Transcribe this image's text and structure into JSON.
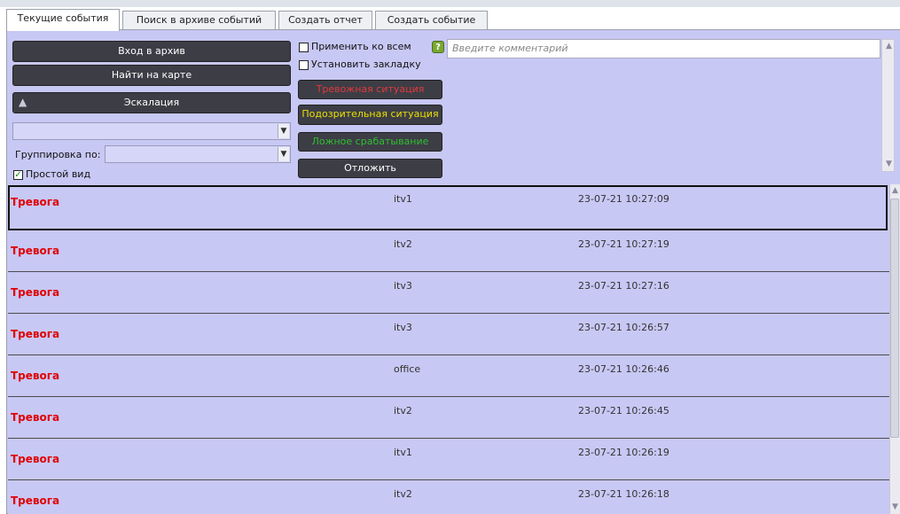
{
  "tabs": [
    {
      "label": "Текущие события",
      "active": true
    },
    {
      "label": "Поиск в архиве событий",
      "active": false
    },
    {
      "label": "Создать отчет",
      "active": false
    },
    {
      "label": "Создать событие",
      "active": false
    }
  ],
  "controls": {
    "archive_button": "Вход в архив",
    "map_button": "Найти на карте",
    "escalation_button": "Эскалация",
    "escalation_combo_value": "",
    "grouping_label": "Группировка по:",
    "grouping_value": "",
    "simple_view_label": "Простой вид",
    "simple_view_checked": true,
    "apply_all_label": "Применить ко всем",
    "apply_all_checked": false,
    "bookmark_label": "Установить закладку",
    "bookmark_checked": false,
    "comment_placeholder": "Введите комментарий",
    "alarm_button": "Тревожная ситуация",
    "suspicious_button": "Подозрительная ситуация",
    "false_button": "Ложное срабатывание",
    "postpone_button": "Отложить"
  },
  "colors": {
    "alarm_text": "#e03a3a",
    "suspicious_text": "#e8e000",
    "false_text": "#2fbf2f",
    "event_title": "#e00000",
    "panel_bg": "#c8c8f5"
  },
  "events": [
    {
      "title": "Тревога",
      "camera": "itv1",
      "datetime": "23-07-21 10:27:09",
      "selected": true
    },
    {
      "title": "Тревога",
      "camera": "itv2",
      "datetime": "23-07-21 10:27:19",
      "selected": false
    },
    {
      "title": "Тревога",
      "camera": "itv3",
      "datetime": "23-07-21 10:27:16",
      "selected": false
    },
    {
      "title": "Тревога",
      "camera": "itv3",
      "datetime": "23-07-21 10:26:57",
      "selected": false
    },
    {
      "title": "Тревога",
      "camera": "office",
      "datetime": "23-07-21 10:26:46",
      "selected": false
    },
    {
      "title": "Тревога",
      "camera": "itv2",
      "datetime": "23-07-21 10:26:45",
      "selected": false
    },
    {
      "title": "Тревога",
      "camera": "itv1",
      "datetime": "23-07-21 10:26:19",
      "selected": false
    },
    {
      "title": "Тревога",
      "camera": "itv2",
      "datetime": "23-07-21 10:26:18",
      "selected": false
    }
  ]
}
